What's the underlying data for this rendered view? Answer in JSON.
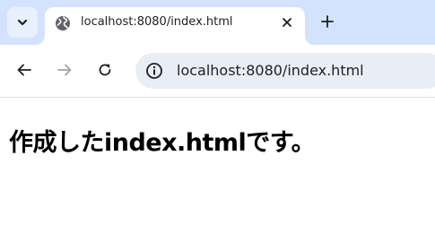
{
  "browser": {
    "tab": {
      "title": "localhost:8080/index.html",
      "favicon_icon": "globe-icon",
      "close_icon": "close-icon"
    },
    "tab_search_icon": "chevron-down-icon",
    "new_tab_icon": "plus-icon",
    "toolbar": {
      "back_icon": "arrow-left-icon",
      "forward_icon": "arrow-right-icon",
      "reload_icon": "reload-icon",
      "site_info_icon": "info-icon",
      "url": "localhost:8080/index.html"
    }
  },
  "page": {
    "heading": "作成したindex.htmlです。"
  },
  "colors": {
    "tabstrip_bg": "#d3e3fd",
    "omnibox_bg": "#e9eef6",
    "icon": "#1f1f1f",
    "icon_disabled": "#a0a4a8"
  }
}
